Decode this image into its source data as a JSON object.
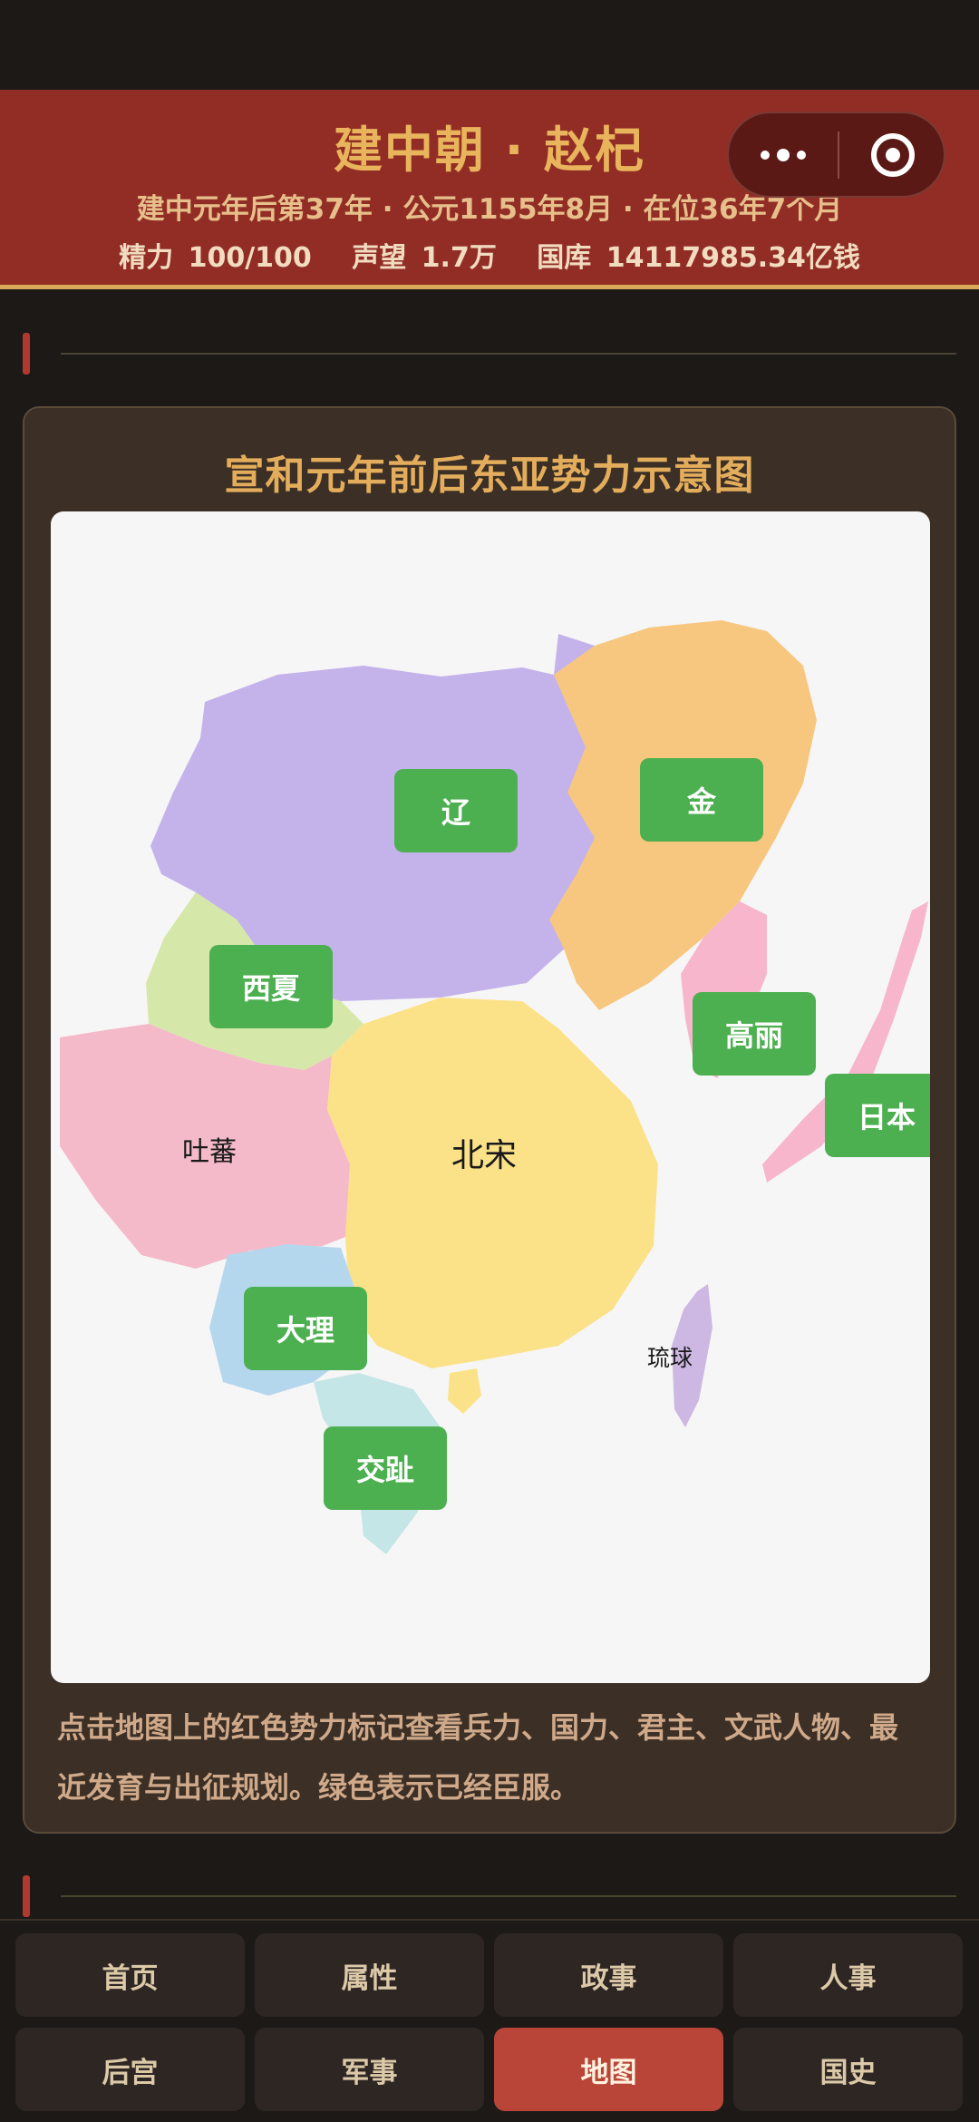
{
  "header": {
    "title": "建中朝 · 赵杞",
    "date_line": "建中元年后第37年 · 公元1155年8月 · 在位36年7个月",
    "stats": {
      "energy": "精力 100/100",
      "prestige": "声望 1.7万",
      "treasury": "国库 14117985.34亿钱"
    }
  },
  "capsule": {
    "more_icon": "more-dots-icon",
    "close_icon": "target-circle-icon"
  },
  "map_card": {
    "title": "宣和元年前后东亚势力示意图",
    "map_labels": {
      "tubo": "吐蕃",
      "beisong": "北宋",
      "liuqiu": "琉球"
    },
    "markers": [
      {
        "id": "liao",
        "label": "辽"
      },
      {
        "id": "jin",
        "label": "金"
      },
      {
        "id": "xixia",
        "label": "西夏"
      },
      {
        "id": "goryeo",
        "label": "高丽"
      },
      {
        "id": "japan",
        "label": "日本"
      },
      {
        "id": "dali",
        "label": "大理"
      },
      {
        "id": "jiaozhi",
        "label": "交趾"
      }
    ],
    "hint": "点击地图上的红色势力标记查看兵力、国力、君主、文武人物、最近发育与出征规划。绿色表示已经臣服。",
    "colors": {
      "liao": "#c4b3ea",
      "jin": "#f8c77f",
      "xixia": "#d5e8a9",
      "tubo": "#f5bac9",
      "beisong": "#fbe289",
      "goryeo_japan": "#f7b6cb",
      "dali": "#b5d7ee",
      "jiaozhi": "#c5e6e6",
      "liuqiu": "#cdb7e3",
      "marker_green": "#4caf50"
    }
  },
  "bottom_nav": {
    "items": [
      {
        "label": "首页",
        "active": false
      },
      {
        "label": "属性",
        "active": false
      },
      {
        "label": "政事",
        "active": false
      },
      {
        "label": "人事",
        "active": false
      },
      {
        "label": "后宫",
        "active": false
      },
      {
        "label": "军事",
        "active": false
      },
      {
        "label": "地图",
        "active": true
      },
      {
        "label": "国史",
        "active": false
      }
    ]
  }
}
